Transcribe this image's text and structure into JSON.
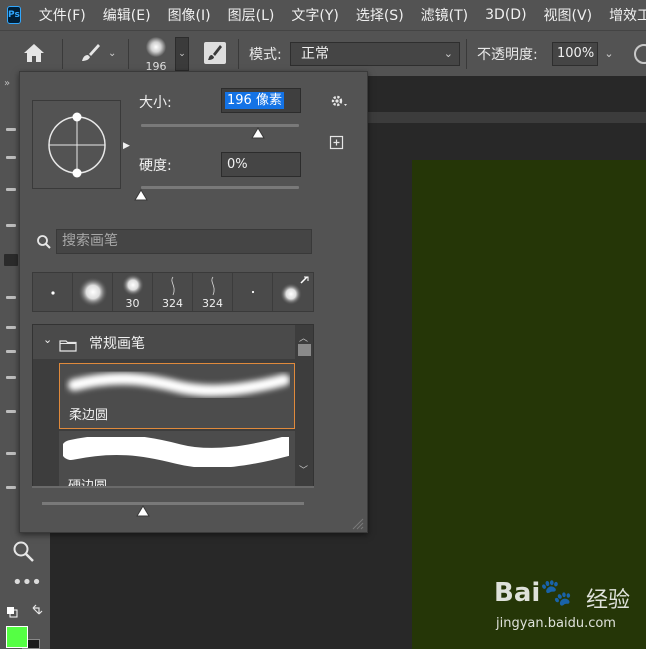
{
  "menubar": {
    "logo": "Ps",
    "items": [
      "文件(F)",
      "编辑(E)",
      "图像(I)",
      "图层(L)",
      "文字(Y)",
      "选择(S)",
      "滤镜(T)",
      "3D(D)",
      "视图(V)",
      "增效工具"
    ]
  },
  "options": {
    "brush_size": "196",
    "mode_label": "模式:",
    "mode_value": "正常",
    "opacity_label": "不透明度:",
    "opacity_value": "100%"
  },
  "panel": {
    "size_label": "大小:",
    "size_value": "196 像素",
    "hardness_label": "硬度:",
    "hardness_value": "0%",
    "search_placeholder": "搜索画笔",
    "recent": [
      {
        "icon": "tiny-dot-brush-icon",
        "label": ""
      },
      {
        "icon": "soft-round-brush-icon",
        "label": ""
      },
      {
        "icon": "soft-round-brush-icon",
        "label": "30"
      },
      {
        "icon": "stroke-brush-icon",
        "label": "324"
      },
      {
        "icon": "stroke-brush-icon",
        "label": "324"
      },
      {
        "icon": "tiny-dot-brush-icon",
        "label": ""
      },
      {
        "icon": "soft-round-brush-icon",
        "label": ""
      }
    ],
    "group_name": "常规画笔",
    "presets": [
      {
        "name": "柔边圆",
        "selected": true
      },
      {
        "name": "硬边圆",
        "selected": false
      }
    ]
  },
  "canvas": {
    "document_color": "#253607"
  },
  "colors": {
    "foreground": "#55ff44",
    "background": "#1a1a1a",
    "accent": "#e08a3c",
    "selection": "#1473e6"
  },
  "watermark": {
    "logo": "Bai🐾",
    "text": "经验",
    "url": "jingyan.baidu.com"
  }
}
